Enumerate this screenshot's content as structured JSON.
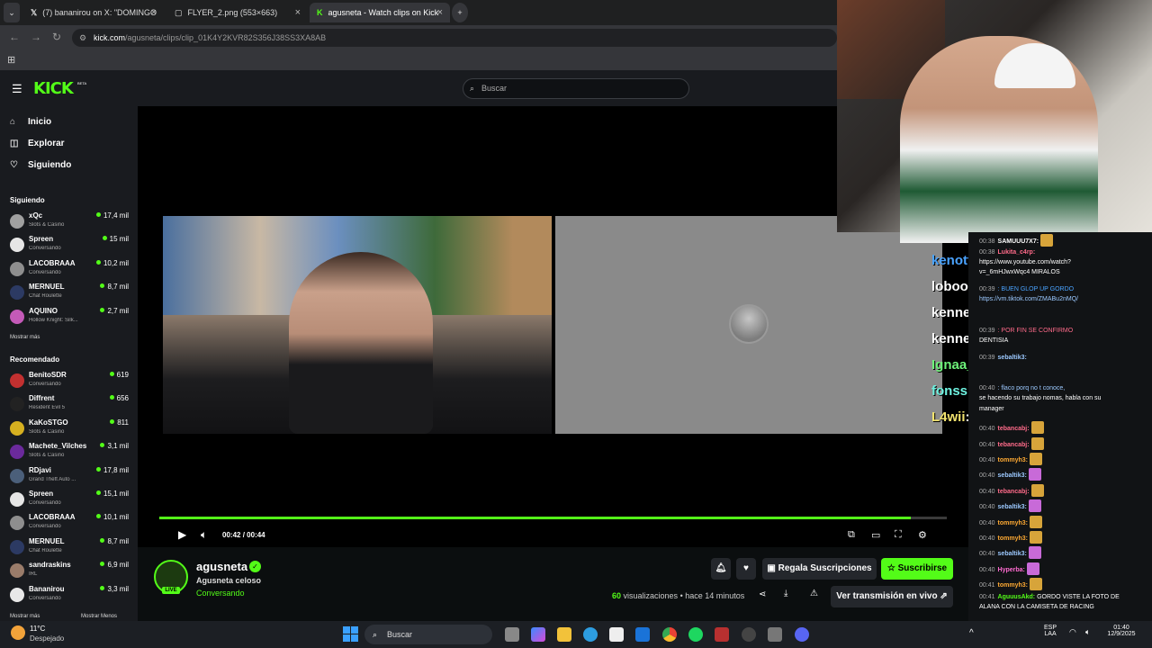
{
  "browser": {
    "tabs": [
      {
        "label": "(7) bananirou on X: \"DOMINGO",
        "active": false
      },
      {
        "label": "FLYER_2.png (553×663)",
        "active": false
      },
      {
        "label": "agusneta - Watch clips on Kick",
        "active": true
      }
    ],
    "url_host": "kick.com",
    "url_path": "/agusneta/clips/clip_01K4Y2KVR82S356J38SS3XA8AB"
  },
  "kick": {
    "logo": "KICK",
    "beta": "BETA",
    "search_placeholder": "Buscar"
  },
  "sidebar": {
    "nav": [
      {
        "label": "Inicio",
        "icon": "home-icon"
      },
      {
        "label": "Explorar",
        "icon": "compass-icon"
      },
      {
        "label": "Siguiendo",
        "icon": "heart-icon"
      }
    ],
    "following_title": "Siguiendo",
    "following": [
      {
        "name": "xQc",
        "category": "Slots & Casino",
        "viewers": "17,4 mil",
        "color": "#a0a0a0"
      },
      {
        "name": "Spreen",
        "category": "Conversando",
        "viewers": "15 mil",
        "color": "#e6e6e6"
      },
      {
        "name": "LACOBRAAA",
        "category": "Conversando",
        "viewers": "10,2 mil",
        "color": "#8e8e8e"
      },
      {
        "name": "MERNUEL",
        "category": "Chat Roulette",
        "viewers": "8,7 mil",
        "color": "#2c3a63"
      },
      {
        "name": "AQUINO",
        "category": "Hollow Knight: Silk...",
        "viewers": "2,7 mil",
        "color": "#c45ab8"
      }
    ],
    "show_more": "Mostrar más",
    "recommended_title": "Recomendado",
    "recommended": [
      {
        "name": "BenitoSDR",
        "category": "Conversando",
        "viewers": "619",
        "color": "#c23030"
      },
      {
        "name": "Diffrent",
        "category": "Resident Evil 5",
        "viewers": "656",
        "color": "#222222"
      },
      {
        "name": "KaKoSTGO",
        "category": "Slots & Casino",
        "viewers": "811",
        "color": "#d6b020"
      },
      {
        "name": "Machete_Vilches",
        "category": "Slots & Casino",
        "viewers": "3,1 mil",
        "color": "#6b2a9c"
      },
      {
        "name": "RDjavi",
        "category": "Grand Theft Auto ...",
        "viewers": "17,8 mil",
        "color": "#4b5f7a"
      },
      {
        "name": "Spreen",
        "category": "Conversando",
        "viewers": "15,1 mil",
        "color": "#e6e6e6"
      },
      {
        "name": "LACOBRAAA",
        "category": "Conversando",
        "viewers": "10,1 mil",
        "color": "#8e8e8e"
      },
      {
        "name": "MERNUEL",
        "category": "Chat Roulette",
        "viewers": "8,7 mil",
        "color": "#2c3a63"
      },
      {
        "name": "sandraskins",
        "category": "IRL",
        "viewers": "6,9 mil",
        "color": "#9a7c6a"
      },
      {
        "name": "Bananirou",
        "category": "Conversando",
        "viewers": "3,3 mil",
        "color": "#e8e8e8"
      }
    ],
    "show_more_bottom": "Mostrar más",
    "show_less_bottom": "Mostrar Menos"
  },
  "player": {
    "time_current": "00:42",
    "time_sep": "/",
    "time_total": "00:44",
    "progress": 0.954
  },
  "stream_overlay_chat": [
    {
      "name": "kenott",
      "sep": ":",
      "color": "#4aa3ff"
    },
    {
      "name": "lobooko",
      "sep": ":",
      "color": "#ffffff"
    },
    {
      "name": "kennerriverar",
      "sep": ":",
      "color": "#ffffff"
    },
    {
      "name": "kennerriverar",
      "sep": ":",
      "color": "#ffffff"
    },
    {
      "name": "Ignaa_sk",
      "sep": ": GIL",
      "color": "#6ef27a"
    },
    {
      "name": "fonssi_gordito",
      "sep": ":",
      "color": "#6ef2e0"
    },
    {
      "name": "L4wii",
      "sep": ":",
      "color": "#f2e36e"
    }
  ],
  "chat": [
    {
      "time": "00:38",
      "user": "SAMUUU7X7:",
      "text": "",
      "color": "#ffffff",
      "emote": "#d7a43a"
    },
    {
      "time": "00:38",
      "user": "Lukita_c4rp:",
      "text": "",
      "color": "#ff6b8a",
      "emote": ""
    },
    {
      "time": "",
      "user": "",
      "text": "https://www.youtube.com/watch?",
      "color": "#ffffff",
      "emote": ""
    },
    {
      "time": "",
      "user": "",
      "text": "v=_6mHJwxWqc4 MIRALOS",
      "color": "#ffffff",
      "emote": ""
    },
    {
      "time": "00:39",
      "user": "",
      "text": ": BUEN GLOP UP GORDO",
      "color": "#4aa3ff",
      "emote": ""
    },
    {
      "time": "",
      "user": "",
      "text": "https://vm.tiktok.com/ZMABu2nMQ/",
      "color": "#9cc9ff",
      "emote": ""
    },
    {
      "time": "00:39",
      "user": "",
      "text": ": POR FIN SE CONFIRMO",
      "color": "#ff6b8a",
      "emote": ""
    },
    {
      "time": "",
      "user": "",
      "text": "DENTISIA",
      "color": "#ffffff",
      "emote": ""
    },
    {
      "time": "00:39",
      "user": "sebaltik3:",
      "text": "",
      "color": "#9cc9ff",
      "emote": ""
    },
    {
      "time": "00:40",
      "user": "",
      "text": ": flaco porq no t conoce,",
      "color": "#9cc9ff",
      "emote": ""
    },
    {
      "time": "",
      "user": "",
      "text": "se hacendo su trabajo nomas, habla con su",
      "color": "#ffffff",
      "emote": ""
    },
    {
      "time": "",
      "user": "",
      "text": "manager",
      "color": "#ffffff",
      "emote": ""
    },
    {
      "time": "00:40",
      "user": "tebancabj:",
      "text": "",
      "color": "#ff6b8a",
      "emote": "#d7a43a"
    },
    {
      "time": "00:40",
      "user": "tebancabj:",
      "text": "",
      "color": "#ff6b8a",
      "emote": "#d7a43a"
    },
    {
      "time": "00:40",
      "user": "tommyh3:",
      "text": "",
      "color": "#ffaa33",
      "emote": "#d7a43a"
    },
    {
      "time": "00:40",
      "user": "sebaltik3:",
      "text": "",
      "color": "#9cc9ff",
      "emote": "#c86ad8"
    },
    {
      "time": "00:40",
      "user": "tebancabj:",
      "text": "",
      "color": "#ff6b8a",
      "emote": "#d7a43a"
    },
    {
      "time": "00:40",
      "user": "sebaltik3:",
      "text": "",
      "color": "#9cc9ff",
      "emote": "#c86ad8"
    },
    {
      "time": "00:40",
      "user": "tommyh3:",
      "text": "",
      "color": "#ffaa33",
      "emote": "#d7a43a"
    },
    {
      "time": "00:40",
      "user": "tommyh3:",
      "text": "",
      "color": "#ffaa33",
      "emote": "#d7a43a"
    },
    {
      "time": "00:40",
      "user": "sebaltik3:",
      "text": "",
      "color": "#9cc9ff",
      "emote": "#c86ad8"
    },
    {
      "time": "00:40",
      "user": "Hyperba:",
      "text": "",
      "color": "#ff6bd1",
      "emote": "#c86ad8"
    },
    {
      "time": "00:41",
      "user": "tommyh3:",
      "text": "",
      "color": "#ffaa33",
      "emote": "#d7a43a"
    },
    {
      "time": "00:41",
      "user": "AguuusAkd:",
      "text": "GORDO VISTE LA FOTO DE",
      "color": "#53fc18",
      "emote": ""
    },
    {
      "time": "",
      "user": "",
      "text": "ALANA CON LA CAMISETA DE RACING",
      "color": "#ffffff",
      "emote": ""
    }
  ],
  "streamer": {
    "name": "agusneta",
    "title": "Agusneta celoso",
    "category": "Conversando",
    "live_badge": "LIVE",
    "gift_label": "Regala Suscripciones",
    "subscribe_label": "Suscribirse",
    "views_count": "60",
    "views_text": "visualizaciones",
    "ago": "• hace 14 minutos",
    "watch_live": "Ver transmisión en vivo"
  },
  "taskbar": {
    "weather_temp": "11°C",
    "weather_desc": "Despejado",
    "search": "Buscar",
    "lang1": "ESP",
    "lang2": "LAA",
    "time": "01:40",
    "date": "12/9/2025"
  }
}
